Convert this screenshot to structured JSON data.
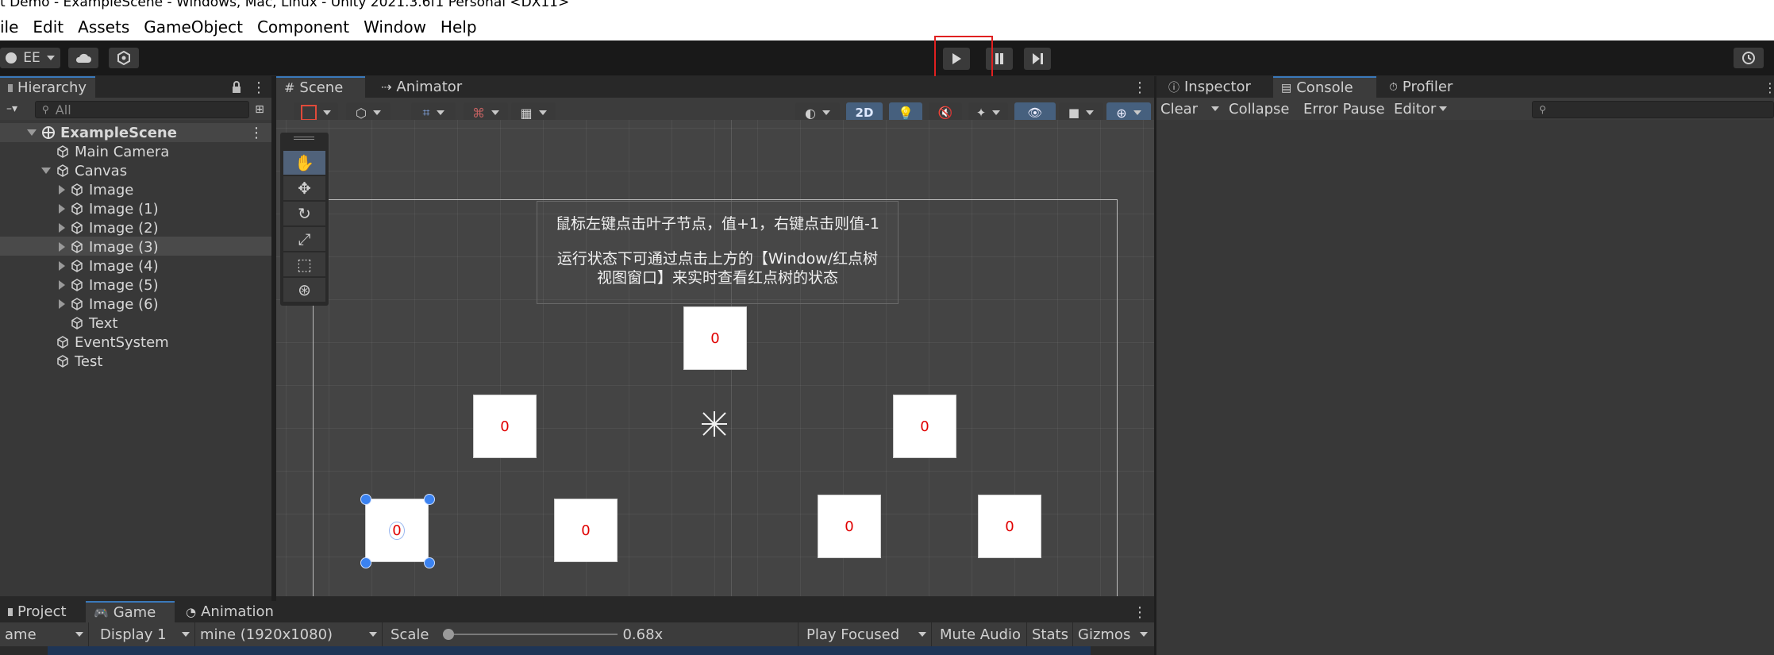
{
  "window": {
    "title": "t Demo - ExampleScene - Windows, Mac, Linux - Unity 2021.3.6f1 Personal <DX11>"
  },
  "menu": {
    "items": [
      "ile",
      "Edit",
      "Assets",
      "GameObject",
      "Component",
      "Window",
      "Help"
    ]
  },
  "toolbar": {
    "account_label": "EE",
    "play_icon": "play-icon",
    "pause_icon": "pause-icon",
    "step_icon": "step-icon",
    "highlight_color": "#e02020"
  },
  "hierarchy": {
    "tab_label": "Hierarchy",
    "search_placeholder": "All",
    "scene_name": "ExampleScene",
    "items": [
      {
        "label": "Main Camera"
      },
      {
        "label": "Canvas"
      },
      {
        "label": "Image"
      },
      {
        "label": "Image (1)"
      },
      {
        "label": "Image (2)"
      },
      {
        "label": "Image (3)"
      },
      {
        "label": "Image (4)"
      },
      {
        "label": "Image (5)"
      },
      {
        "label": "Image (6)"
      },
      {
        "label": "Text"
      },
      {
        "label": "EventSystem"
      },
      {
        "label": "Test"
      }
    ]
  },
  "scene": {
    "tabs": [
      {
        "label": "Scene"
      },
      {
        "label": "Animator"
      }
    ],
    "mode_2d_label": "2D",
    "instruction_line1": "鼠标左键点击叶子节点，值+1，右键点击则值-1",
    "instruction_line2": "运行状态下可通过点击上方的【Window/红点树",
    "instruction_line3": "视图窗口】来实时查看红点树的状态",
    "nodes": [
      {
        "value": "0"
      },
      {
        "value": "0"
      },
      {
        "value": "0"
      },
      {
        "value": "0"
      },
      {
        "value": "0"
      },
      {
        "value": "0"
      },
      {
        "value": "0"
      }
    ]
  },
  "game": {
    "tabs": [
      {
        "label": "Project"
      },
      {
        "label": "Game"
      },
      {
        "label": "Animation"
      }
    ],
    "view_label": "ame",
    "display_label": "Display 1",
    "resolution_label": "mine (1920x1080)",
    "scale_label": "Scale",
    "scale_value": "0.68x",
    "scale_fraction": 0.0,
    "play_focused_label": "Play Focused",
    "mute_label": "Mute Audio",
    "stats_label": "Stats",
    "gizmos_label": "Gizmos"
  },
  "right_panel": {
    "tabs": [
      {
        "label": "Inspector"
      },
      {
        "label": "Console"
      },
      {
        "label": "Profiler"
      }
    ],
    "clear_label": "Clear",
    "collapse_label": "Collapse",
    "error_pause_label": "Error Pause",
    "editor_label": "Editor"
  }
}
